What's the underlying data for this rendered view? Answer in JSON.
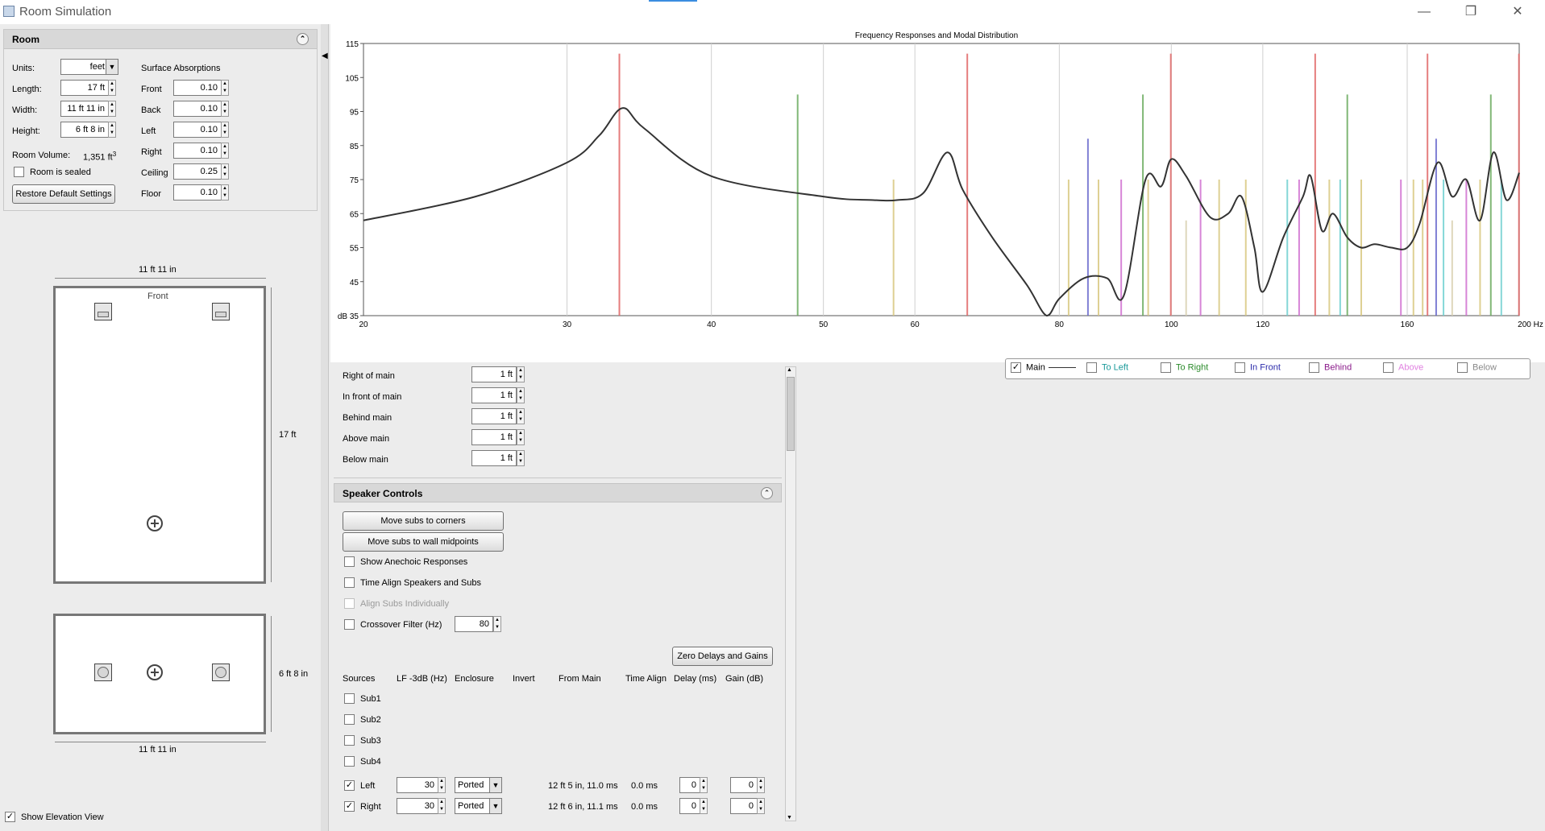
{
  "window": {
    "title": "Room Simulation",
    "minimize": "—",
    "restore": "❐",
    "close": "✕"
  },
  "room": {
    "header": "Room",
    "collapse_icon": "⌃",
    "units_label": "Units:",
    "units_value": "feet",
    "length_label": "Length:",
    "length_value": "17 ft",
    "width_label": "Width:",
    "width_value": "11 ft 11 in",
    "height_label": "Height:",
    "height_value": "6 ft 8 in",
    "volume_label": "Room Volume:",
    "volume_value": "1,351 ft",
    "volume_sup": "3",
    "sealed_label": "Room is sealed",
    "restore_button": "Restore Default Settings",
    "absorptions_title": "Surface Absorptions",
    "absorptions": [
      {
        "label": "Front",
        "value": "0.10"
      },
      {
        "label": "Back",
        "value": "0.10"
      },
      {
        "label": "Left",
        "value": "0.10"
      },
      {
        "label": "Right",
        "value": "0.10"
      },
      {
        "label": "Ceiling",
        "value": "0.25"
      },
      {
        "label": "Floor",
        "value": "0.10"
      }
    ]
  },
  "plan": {
    "top_width_label": "11 ft 11 in",
    "front_label": "Front",
    "length_label": "17 ft",
    "elev_height_label": "6 ft 8 in",
    "bottom_width_label": "11 ft 11 in"
  },
  "show_elevation_label": "Show Elevation View",
  "chart": {
    "title": "Frequency Responses and Modal Distribution",
    "y_ticks": [
      "115",
      "105",
      "95",
      "85",
      "75",
      "65",
      "55",
      "45",
      "dB 35"
    ],
    "x_ticks": [
      "20",
      "30",
      "40",
      "50",
      "60",
      "80",
      "100",
      "120",
      "160",
      "200 Hz"
    ]
  },
  "chart_data": {
    "type": "line",
    "title": "Frequency Responses and Modal Distribution",
    "xlabel": "Hz",
    "ylabel": "dB",
    "x_scale": "log",
    "xlim": [
      20,
      200
    ],
    "ylim": [
      35,
      115
    ],
    "series": [
      {
        "name": "Main",
        "x": [
          20,
          25,
          30,
          32,
          33.5,
          35,
          40,
          50,
          55,
          58,
          61,
          64,
          66,
          70,
          75,
          78,
          80,
          84,
          88,
          91,
          95,
          98,
          100,
          103,
          108,
          112,
          115,
          118,
          120,
          125,
          130,
          132,
          135,
          138,
          142,
          146,
          150,
          155,
          160,
          164,
          170,
          175,
          180,
          185,
          190,
          195,
          200
        ],
        "y": [
          63,
          70,
          80,
          88,
          96,
          90,
          76,
          70,
          69,
          69,
          71,
          83,
          72,
          58,
          44,
          35,
          40,
          46,
          46,
          41,
          75,
          73,
          81,
          76,
          64,
          65,
          70,
          55,
          42,
          58,
          70,
          76,
          60,
          65,
          58,
          55,
          56,
          55,
          55,
          62,
          80,
          70,
          75,
          63,
          83,
          69,
          77
        ]
      }
    ],
    "modes": [
      {
        "hz": 33.3,
        "group": "axial-length",
        "color": "#e06666",
        "level": 112
      },
      {
        "hz": 47.5,
        "group": "axial-width",
        "color": "#6aaa5e",
        "level": 100
      },
      {
        "hz": 57.5,
        "group": "tangential",
        "color": "#d8c880",
        "level": 75
      },
      {
        "hz": 66.6,
        "group": "axial-length",
        "color": "#e06666",
        "level": 112
      },
      {
        "hz": 81.5,
        "group": "tangential",
        "color": "#d8c880",
        "level": 75
      },
      {
        "hz": 84.7,
        "group": "axial-height",
        "color": "#6a6acc",
        "level": 87
      },
      {
        "hz": 86.5,
        "group": "tangential",
        "color": "#d8c880",
        "level": 75
      },
      {
        "hz": 90.5,
        "group": "oblique",
        "color": "#d070d0",
        "level": 75
      },
      {
        "hz": 94.5,
        "group": "axial-width",
        "color": "#6aaa5e",
        "level": 100
      },
      {
        "hz": 95.5,
        "group": "tangential",
        "color": "#d8c880",
        "level": 75
      },
      {
        "hz": 99.9,
        "group": "axial-length",
        "color": "#e06666",
        "level": 112
      },
      {
        "hz": 103,
        "group": "oblique-faint",
        "color": "#d8d0b0",
        "level": 63
      },
      {
        "hz": 106,
        "group": "oblique",
        "color": "#d070d0",
        "level": 75
      },
      {
        "hz": 110,
        "group": "tangential",
        "color": "#d8c880",
        "level": 75
      },
      {
        "hz": 116,
        "group": "tangential",
        "color": "#d8c880",
        "level": 75
      },
      {
        "hz": 126,
        "group": "cross",
        "color": "#70d0d0",
        "level": 75
      },
      {
        "hz": 129,
        "group": "oblique",
        "color": "#d070d0",
        "level": 75
      },
      {
        "hz": 133.2,
        "group": "axial-length",
        "color": "#e06666",
        "level": 112
      },
      {
        "hz": 137,
        "group": "tangential",
        "color": "#d8c880",
        "level": 75
      },
      {
        "hz": 140,
        "group": "cross",
        "color": "#70d0d0",
        "level": 75
      },
      {
        "hz": 142,
        "group": "axial-width",
        "color": "#6aaa5e",
        "level": 100
      },
      {
        "hz": 146,
        "group": "tangential",
        "color": "#d8c880",
        "level": 75
      },
      {
        "hz": 158,
        "group": "oblique",
        "color": "#d070d0",
        "level": 75
      },
      {
        "hz": 162,
        "group": "tangential",
        "color": "#d8c880",
        "level": 75
      },
      {
        "hz": 165,
        "group": "tangential",
        "color": "#d8c880",
        "level": 75
      },
      {
        "hz": 166.6,
        "group": "axial-length",
        "color": "#e06666",
        "level": 112
      },
      {
        "hz": 169.5,
        "group": "axial-height",
        "color": "#6a6acc",
        "level": 87
      },
      {
        "hz": 172,
        "group": "cross",
        "color": "#70d0d0",
        "level": 75
      },
      {
        "hz": 175,
        "group": "oblique-faint",
        "color": "#d8d0b0",
        "level": 63
      },
      {
        "hz": 180,
        "group": "oblique",
        "color": "#d070d0",
        "level": 75
      },
      {
        "hz": 185,
        "group": "tangential",
        "color": "#d8c880",
        "level": 75
      },
      {
        "hz": 189,
        "group": "axial-width",
        "color": "#6aaa5e",
        "level": 100
      },
      {
        "hz": 193,
        "group": "cross",
        "color": "#70d0d0",
        "level": 75
      },
      {
        "hz": 199.9,
        "group": "axial-length",
        "color": "#e06666",
        "level": 112
      }
    ]
  },
  "legend": [
    {
      "label": "Main",
      "checked": true,
      "color": "#000000"
    },
    {
      "label": "To Left",
      "checked": false,
      "color": "#1a9a9a"
    },
    {
      "label": "To Right",
      "checked": false,
      "color": "#2a8a2a"
    },
    {
      "label": "In Front",
      "checked": false,
      "color": "#2a2aaa"
    },
    {
      "label": "Behind",
      "checked": false,
      "color": "#8a1a8a"
    },
    {
      "label": "Above",
      "checked": false,
      "color": "#e080e0"
    },
    {
      "label": "Below",
      "checked": false,
      "color": "#8a8a8a"
    }
  ],
  "offsets": [
    {
      "label": "Right of main",
      "value": "1 ft"
    },
    {
      "label": "In front of main",
      "value": "1 ft"
    },
    {
      "label": "Behind main",
      "value": "1 ft"
    },
    {
      "label": "Above main",
      "value": "1 ft"
    },
    {
      "label": "Below main",
      "value": "1 ft"
    }
  ],
  "speaker_controls": {
    "header": "Speaker Controls",
    "move_corners": "Move subs to corners",
    "move_midpoints": "Move subs to wall midpoints",
    "show_anechoic": "Show Anechoic Responses",
    "time_align": "Time Align Speakers and Subs",
    "align_subs": "Align Subs Individually",
    "crossover": "Crossover Filter (Hz)",
    "crossover_value": "80",
    "zero_delays": "Zero Delays and Gains",
    "columns": [
      "Sources",
      "LF -3dB (Hz)",
      "Enclosure",
      "Invert",
      "From Main",
      "Time Align",
      "Delay (ms)",
      "Gain (dB)"
    ],
    "subs": [
      "Sub1",
      "Sub2",
      "Sub3",
      "Sub4"
    ],
    "mains": [
      {
        "name": "Left",
        "lf": "30",
        "enclosure": "Ported",
        "from_main": "12 ft 5 in, 11.0 ms",
        "time_align": "0.0 ms",
        "delay": "0",
        "gain": "0"
      },
      {
        "name": "Right",
        "lf": "30",
        "enclosure": "Ported",
        "from_main": "12 ft 6 in, 11.1 ms",
        "time_align": "0.0 ms",
        "delay": "0",
        "gain": "0"
      }
    ]
  }
}
